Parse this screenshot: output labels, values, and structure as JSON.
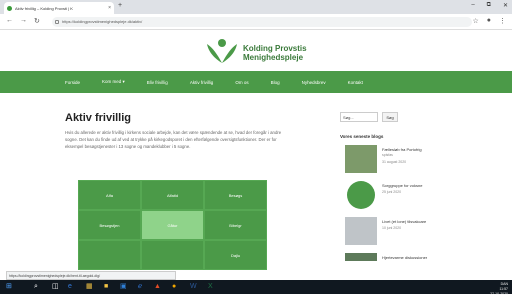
{
  "browser": {
    "tab_title": "Aktiv frivillig – Kolding Provsti | K",
    "tab_close": "×",
    "new_tab": "+",
    "url": "https://koldingprovstimenighedspleje.dk/aktiv/",
    "window_controls": [
      "–",
      "⧉",
      "✕"
    ]
  },
  "site": {
    "logo_line1": "Kolding Provstis",
    "logo_line2": "Menighedspleje",
    "brand_green": "#4b9a48",
    "nav": [
      "Forside",
      "Kom med ▾",
      "Bliv frivillig",
      "Aktiv frivillig",
      "Om os",
      "Blog",
      "Nyhedsbrev",
      "Kontakt"
    ]
  },
  "main": {
    "title": "Aktiv frivillig",
    "intro": "Hvis du allerede er aktiv frivillig i kirkens sociale arbejde, kan det være spændende at se, hvad der foregår i andre sogne. Det kan du finde ud af ved at trykke på kirkegodsporet i den efterfølgende oversigtsfunktioner. Der er for eksempel besøgstjenester i 13 sogne og mandeklubber i 5 sogne.",
    "grid": [
      {
        "label": "Alfa",
        "active": false
      },
      {
        "label": "Alfatid",
        "active": false
      },
      {
        "label": "Besøgs",
        "active": false
      },
      {
        "label": "Besøgstjen",
        "active": false
      },
      {
        "label": "Gåtur",
        "active": true
      },
      {
        "label": "Bibelgr",
        "active": false
      },
      {
        "label": "",
        "active": false
      },
      {
        "label": "",
        "active": false
      },
      {
        "label": "Dajlu",
        "active": false
      }
    ]
  },
  "sidebar": {
    "search_value": "Søg...",
    "search_button": "Søg",
    "section_title": "Vores seneste blogs",
    "posts": [
      {
        "title": "Fællesløb fra Portofrig",
        "subtitle": "spisfas",
        "date": "31 august 2020"
      },
      {
        "title": "Sorggruppe for voksne",
        "subtitle": "",
        "date": "25 juni 2020"
      },
      {
        "title": "Livet (et lone) tilsvakcare",
        "subtitle": "",
        "date": "10 juni 2020"
      },
      {
        "title": "Hjertevarme diskussioner",
        "subtitle": "",
        "date": ""
      }
    ]
  },
  "statusbar": {
    "text": "https://koldingprovstimenighedspleje.dk/hent-til-aegold-dig/"
  },
  "taskbar": {
    "time": "11:57",
    "date": "27-10-2020",
    "lang": "DAN"
  }
}
